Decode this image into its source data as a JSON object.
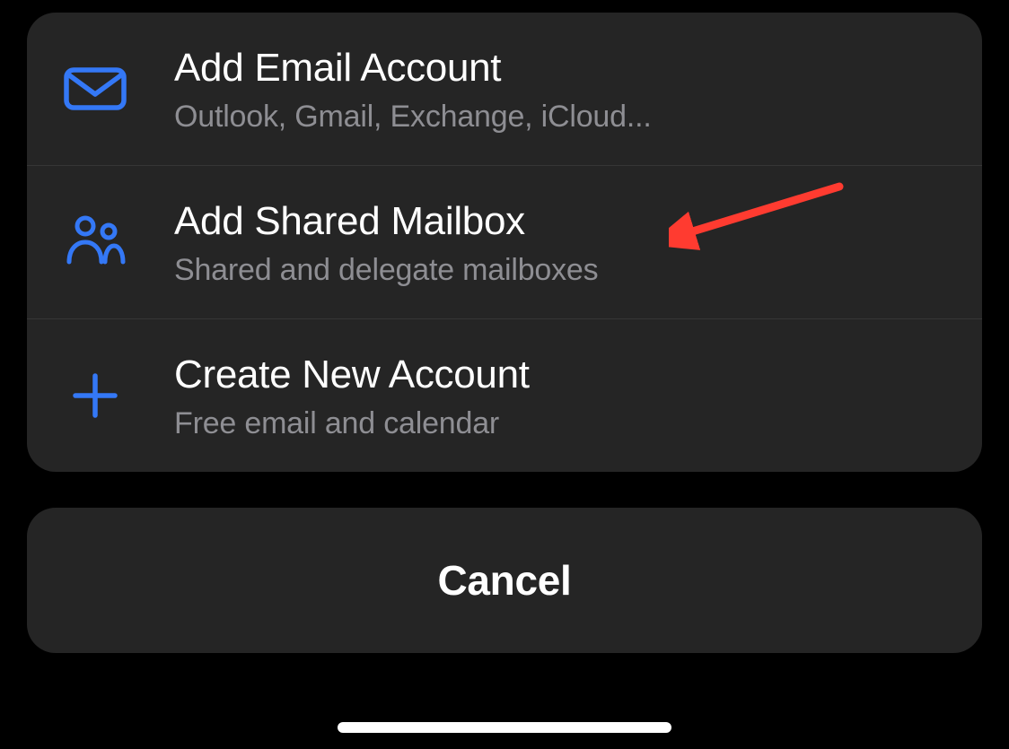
{
  "options": [
    {
      "title": "Add Email Account",
      "subtitle": "Outlook, Gmail, Exchange, iCloud...",
      "icon": "mail-icon"
    },
    {
      "title": "Add Shared Mailbox",
      "subtitle": "Shared and delegate mailboxes",
      "icon": "people-icon"
    },
    {
      "title": "Create New Account",
      "subtitle": "Free email and calendar",
      "icon": "plus-icon"
    }
  ],
  "cancel_label": "Cancel",
  "colors": {
    "accent": "#3478f6",
    "annotation": "#ff3b30"
  }
}
